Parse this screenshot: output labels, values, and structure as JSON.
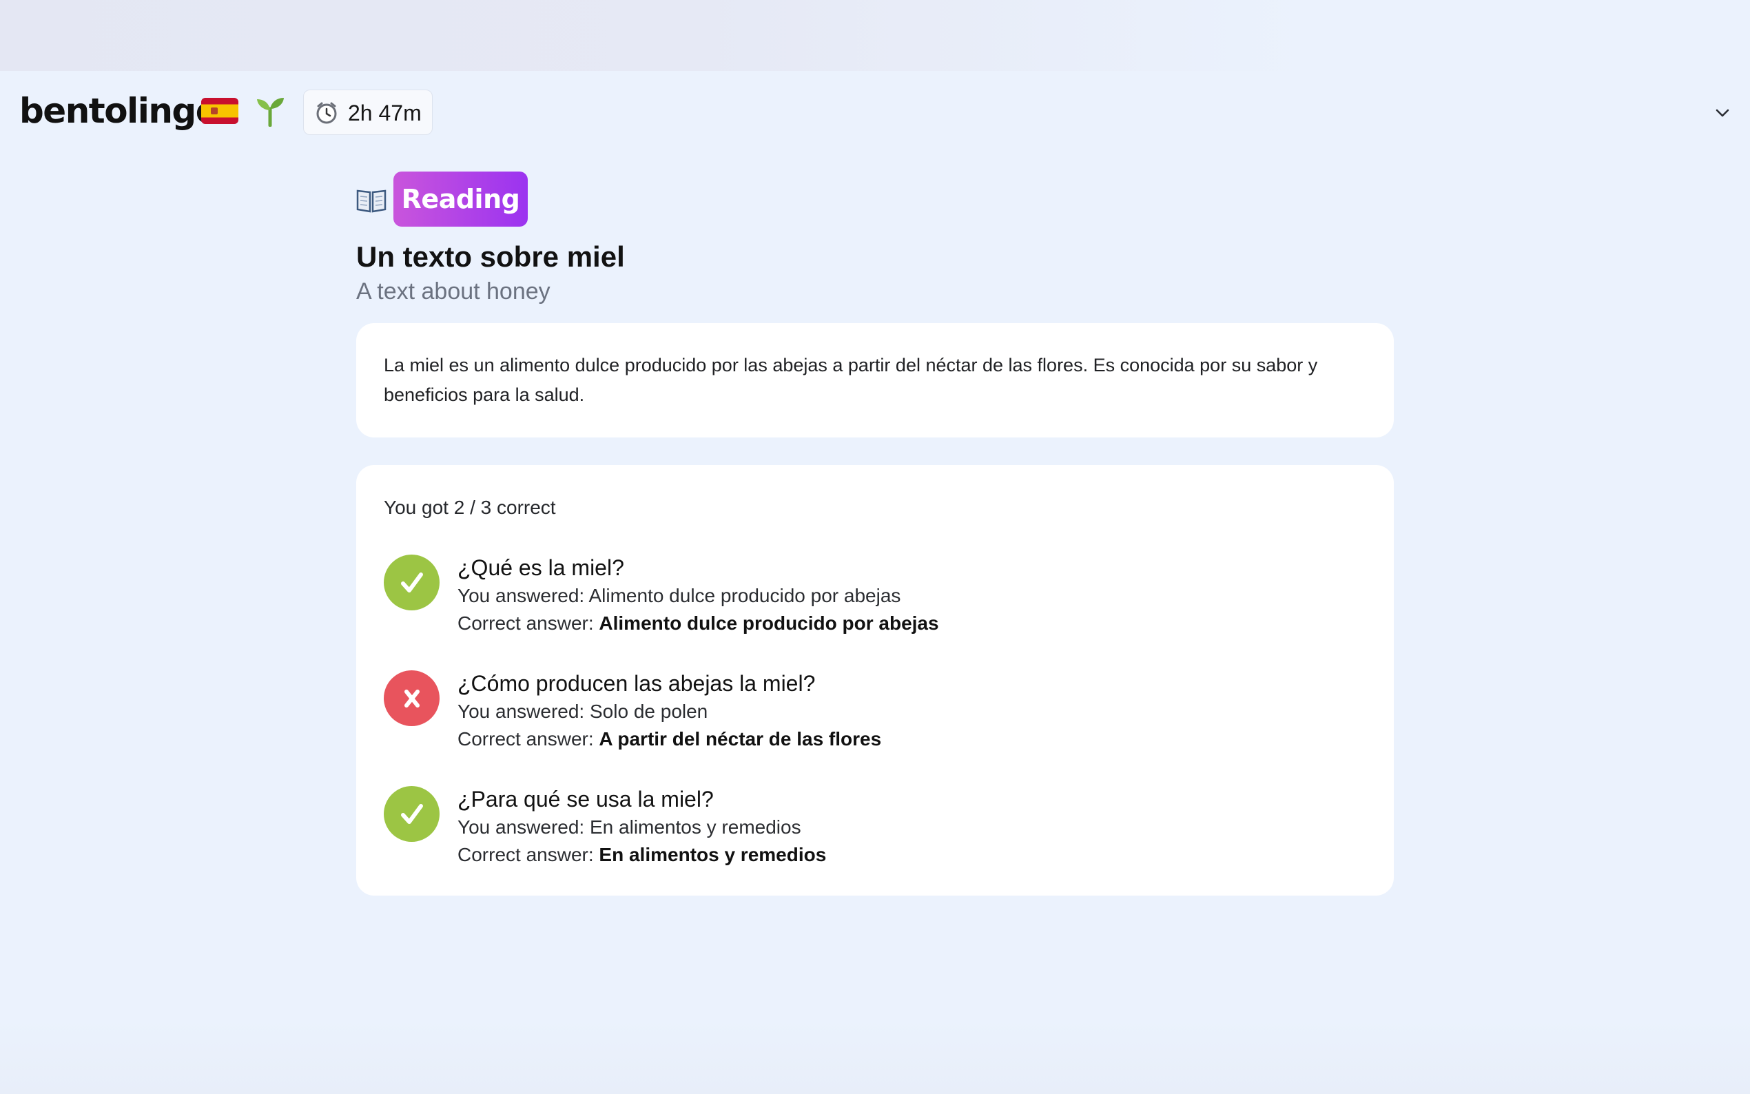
{
  "header": {
    "logo": "bentolingo",
    "flag_icon": "spain-flag-icon",
    "streak_icon": "sprout-icon",
    "timer": {
      "icon": "alarm-clock-icon",
      "value": "2h 47m"
    },
    "menu_icon": "chevron-down-icon"
  },
  "lesson": {
    "type_icon": "open-book-icon",
    "type_label": "Reading",
    "title": "Un texto sobre miel",
    "subtitle": "A text about honey",
    "passage": "La miel es un alimento dulce producido por las abejas a partir del néctar de las flores. Es conocida por su sabor y beneficios para la salud."
  },
  "results": {
    "score": "You got 2 / 3 correct",
    "you_answered_label": "You answered:",
    "correct_answer_label": "Correct answer:",
    "questions": [
      {
        "question": "¿Qué es la miel?",
        "your_answer": "Alimento dulce producido por abejas",
        "correct_answer": "Alimento dulce producido por abejas",
        "status": "correct"
      },
      {
        "question": "¿Cómo producen las abejas la miel?",
        "your_answer": "Solo de polen",
        "correct_answer": "A partir del néctar de las flores",
        "status": "incorrect"
      },
      {
        "question": "¿Para qué se usa la miel?",
        "your_answer": "En alimentos y remedios",
        "correct_answer": "En alimentos y remedios",
        "status": "correct"
      }
    ]
  },
  "colors": {
    "background": "#ebf2fd",
    "correct": "#9cc544",
    "incorrect": "#e8545d",
    "pill_start": "#c955dc",
    "pill_end": "#9b33f0"
  }
}
